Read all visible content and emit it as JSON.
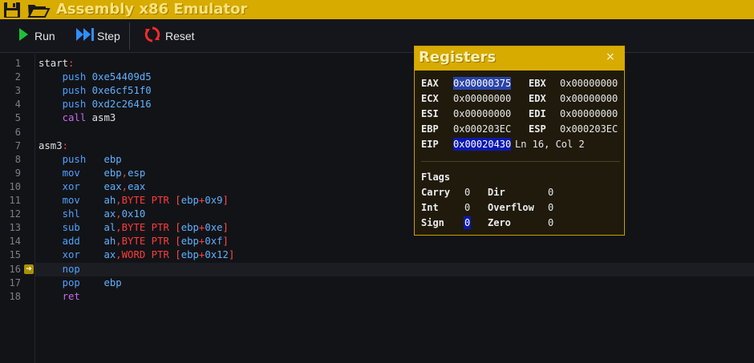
{
  "app": {
    "title": "Assembly x86 Emulator",
    "icons": [
      "save-icon",
      "open-folder-icon"
    ]
  },
  "toolbar": {
    "run_label": "Run",
    "step_label": "Step",
    "reset_label": "Reset",
    "colors": {
      "run": "#1fbf3a",
      "step": "#2f8fff",
      "reset": "#ff2a2a"
    }
  },
  "editor": {
    "current_line": 16,
    "lines": [
      {
        "n": "1",
        "parts": [
          {
            "t": "start",
            "c": ""
          },
          {
            "t": ":",
            "c": "lbl-red"
          }
        ]
      },
      {
        "n": "2",
        "parts": [
          {
            "t": "    push ",
            "c": "kw-blue"
          },
          {
            "t": "0xe54409d5",
            "c": "num-blue"
          }
        ]
      },
      {
        "n": "3",
        "parts": [
          {
            "t": "    push ",
            "c": "kw-blue"
          },
          {
            "t": "0xe6cf51f0",
            "c": "num-blue"
          }
        ]
      },
      {
        "n": "4",
        "parts": [
          {
            "t": "    push ",
            "c": "kw-blue"
          },
          {
            "t": "0xd2c26416",
            "c": "num-blue"
          }
        ]
      },
      {
        "n": "5",
        "parts": [
          {
            "t": "    call ",
            "c": "kw-purple"
          },
          {
            "t": "asm3",
            "c": ""
          }
        ]
      },
      {
        "n": "6",
        "parts": []
      },
      {
        "n": "7",
        "parts": [
          {
            "t": "asm3",
            "c": ""
          },
          {
            "t": ":",
            "c": "lbl-red"
          }
        ]
      },
      {
        "n": "8",
        "parts": [
          {
            "t": "    push   ",
            "c": "kw-blue"
          },
          {
            "t": "ebp",
            "c": "num-blue"
          }
        ]
      },
      {
        "n": "9",
        "parts": [
          {
            "t": "    mov    ",
            "c": "kw-blue"
          },
          {
            "t": "ebp",
            "c": "num-blue"
          },
          {
            "t": ",",
            "c": "kw-red"
          },
          {
            "t": "esp",
            "c": "num-blue"
          }
        ]
      },
      {
        "n": "10",
        "parts": [
          {
            "t": "    xor    ",
            "c": "kw-blue"
          },
          {
            "t": "eax",
            "c": "num-blue"
          },
          {
            "t": ",",
            "c": "kw-red"
          },
          {
            "t": "eax",
            "c": "num-blue"
          }
        ]
      },
      {
        "n": "11",
        "parts": [
          {
            "t": "    mov    ",
            "c": "kw-blue"
          },
          {
            "t": "ah",
            "c": "num-blue"
          },
          {
            "t": ",BYTE PTR ",
            "c": "kw-red"
          },
          {
            "t": "[",
            "c": "bracket"
          },
          {
            "t": "ebp",
            "c": "num-blue"
          },
          {
            "t": "+",
            "c": "kw-red"
          },
          {
            "t": "0x9",
            "c": "num-blue"
          },
          {
            "t": "]",
            "c": "bracket"
          }
        ]
      },
      {
        "n": "12",
        "parts": [
          {
            "t": "    shl    ",
            "c": "kw-blue"
          },
          {
            "t": "ax",
            "c": "num-blue"
          },
          {
            "t": ",",
            "c": "kw-red"
          },
          {
            "t": "0x10",
            "c": "num-blue"
          }
        ]
      },
      {
        "n": "13",
        "parts": [
          {
            "t": "    sub    ",
            "c": "kw-blue"
          },
          {
            "t": "al",
            "c": "num-blue"
          },
          {
            "t": ",BYTE PTR ",
            "c": "kw-red"
          },
          {
            "t": "[",
            "c": "bracket"
          },
          {
            "t": "ebp",
            "c": "num-blue"
          },
          {
            "t": "+",
            "c": "kw-red"
          },
          {
            "t": "0xe",
            "c": "num-blue"
          },
          {
            "t": "]",
            "c": "bracket"
          }
        ]
      },
      {
        "n": "14",
        "parts": [
          {
            "t": "    add    ",
            "c": "kw-blue"
          },
          {
            "t": "ah",
            "c": "num-blue"
          },
          {
            "t": ",BYTE PTR ",
            "c": "kw-red"
          },
          {
            "t": "[",
            "c": "bracket"
          },
          {
            "t": "ebp",
            "c": "num-blue"
          },
          {
            "t": "+",
            "c": "kw-red"
          },
          {
            "t": "0xf",
            "c": "num-blue"
          },
          {
            "t": "]",
            "c": "bracket"
          }
        ]
      },
      {
        "n": "15",
        "parts": [
          {
            "t": "    xor    ",
            "c": "kw-blue"
          },
          {
            "t": "ax",
            "c": "num-blue"
          },
          {
            "t": ",WORD PTR ",
            "c": "kw-red"
          },
          {
            "t": "[",
            "c": "bracket"
          },
          {
            "t": "ebp",
            "c": "num-blue"
          },
          {
            "t": "+",
            "c": "kw-red"
          },
          {
            "t": "0x12",
            "c": "num-blue"
          },
          {
            "t": "]",
            "c": "bracket"
          }
        ]
      },
      {
        "n": "16",
        "parts": [
          {
            "t": "    nop",
            "c": "kw-blue"
          }
        ]
      },
      {
        "n": "17",
        "parts": [
          {
            "t": "    pop    ",
            "c": "kw-blue"
          },
          {
            "t": "ebp",
            "c": "num-blue"
          }
        ]
      },
      {
        "n": "18",
        "parts": [
          {
            "t": "    ret",
            "c": "kw-purple"
          }
        ]
      }
    ]
  },
  "registers": {
    "title": "Registers",
    "close_glyph": "×",
    "rows": [
      {
        "left_name": "EAX",
        "left_value": "0x00000375",
        "right_name": "EBX",
        "right_value": "0x00000000"
      },
      {
        "left_name": "ECX",
        "left_value": "0x00000000",
        "right_name": "EDX",
        "right_value": "0x00000000"
      },
      {
        "left_name": "ESI",
        "left_value": "0x00000000",
        "right_name": "EDI",
        "right_value": "0x00000000"
      },
      {
        "left_name": "EBP",
        "left_value": "0x000203EC",
        "right_name": "ESP",
        "right_value": "0x000203EC"
      }
    ],
    "eip_name": "EIP",
    "eip_value": "0x00020430",
    "cursor_status": "Ln 16, Col 2",
    "flags_title": "Flags",
    "flags": [
      {
        "name": "Carry",
        "value": "0"
      },
      {
        "name": "Dir",
        "value": "0"
      },
      {
        "name": "Int",
        "value": "0"
      },
      {
        "name": "Overflow",
        "value": "0"
      },
      {
        "name": "Sign",
        "value": "0"
      },
      {
        "name": "Zero",
        "value": "0"
      }
    ]
  }
}
